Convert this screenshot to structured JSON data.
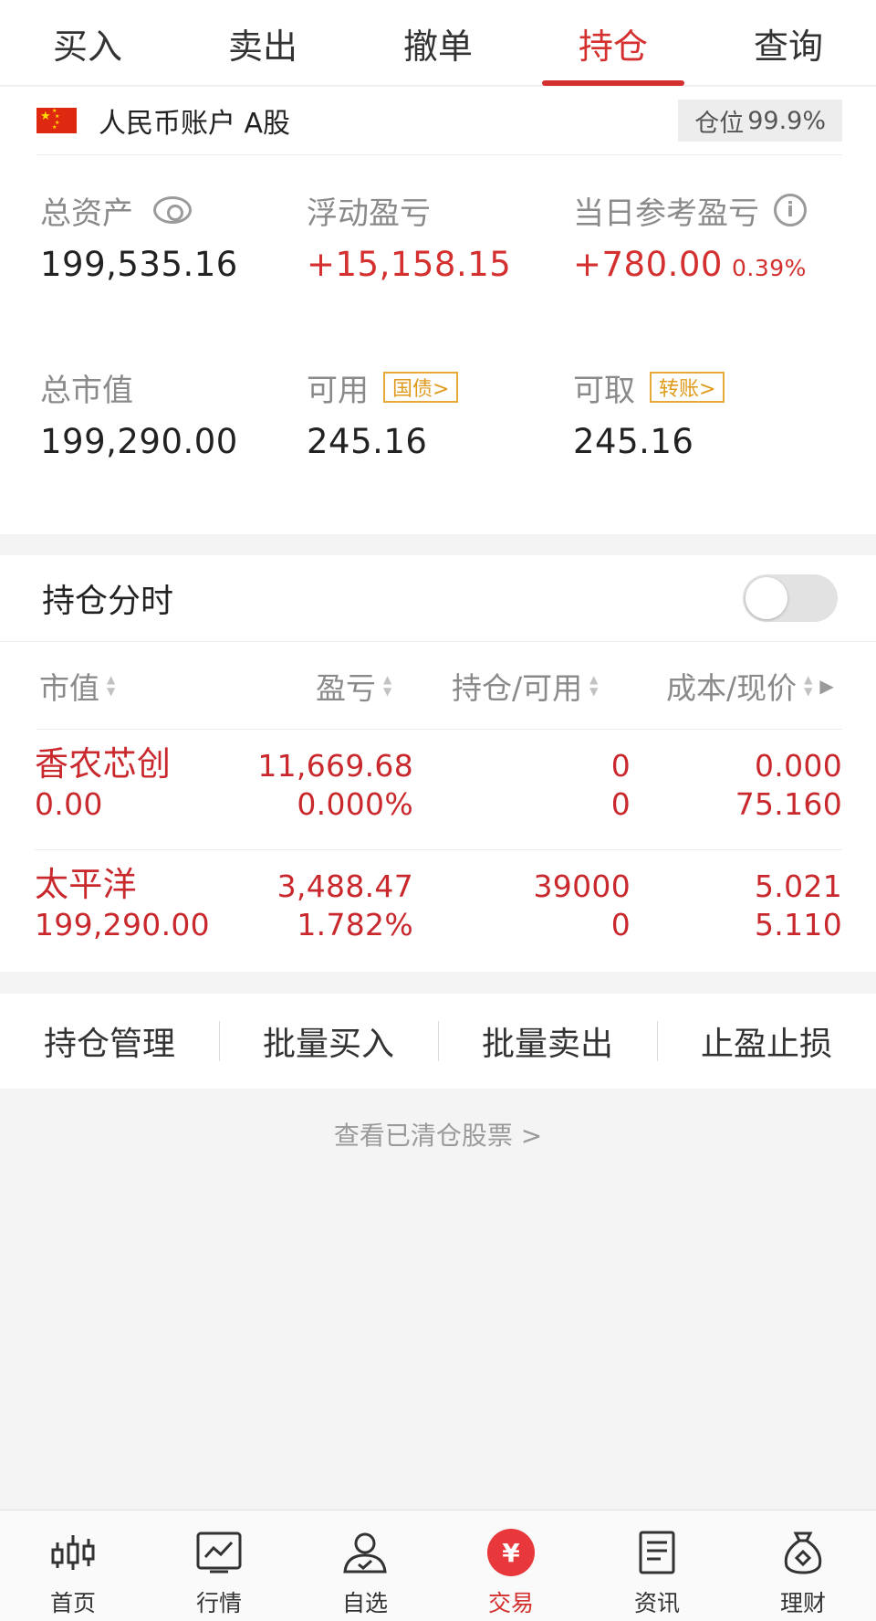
{
  "top_tabs": [
    "买入",
    "卖出",
    "撤单",
    "持仓",
    "查询"
  ],
  "active_tab": "持仓",
  "account": {
    "name": "人民币账户 A股",
    "position_label": "仓位",
    "position_value": "99.9%"
  },
  "stats": {
    "total_assets_label": "总资产",
    "total_assets": "199,535.16",
    "floating_pl_label": "浮动盈亏",
    "floating_pl": "+15,158.15",
    "daily_pl_label": "当日参考盈亏",
    "daily_pl": "+780.00",
    "daily_pl_pct": "0.39%",
    "market_value_label": "总市值",
    "market_value": "199,290.00",
    "available_label": "可用",
    "available_link": "国债>",
    "available": "245.16",
    "withdrawable_label": "可取",
    "withdrawable_link": "转账>",
    "withdrawable": "245.16"
  },
  "holdings": {
    "title": "持仓分时",
    "columns": [
      "市值",
      "盈亏",
      "持仓/可用",
      "成本/现价"
    ],
    "rows": [
      {
        "name": "香农芯创",
        "market_value": "0.00",
        "pl": "11,669.68",
        "pl_pct": "0.000%",
        "position": "0",
        "available": "0",
        "cost": "0.000",
        "price": "75.160"
      },
      {
        "name": "太平洋",
        "market_value": "199,290.00",
        "pl": "3,488.47",
        "pl_pct": "1.782%",
        "position": "39000",
        "available": "0",
        "cost": "5.021",
        "price": "5.110"
      }
    ]
  },
  "actions": [
    "持仓管理",
    "批量买入",
    "批量卖出",
    "止盈止损"
  ],
  "cleared_link": "查看已清仓股票 >",
  "bottom_nav": [
    {
      "label": "首页",
      "icon": "candlestick-icon"
    },
    {
      "label": "行情",
      "icon": "line-chart-icon"
    },
    {
      "label": "自选",
      "icon": "user-check-icon"
    },
    {
      "label": "交易",
      "icon": "yen-icon"
    },
    {
      "label": "资讯",
      "icon": "document-icon"
    },
    {
      "label": "理财",
      "icon": "money-bag-icon"
    }
  ],
  "colors": {
    "accent": "#d3302f",
    "gain": "#c9282d",
    "link_badge": "#e09a1b"
  }
}
